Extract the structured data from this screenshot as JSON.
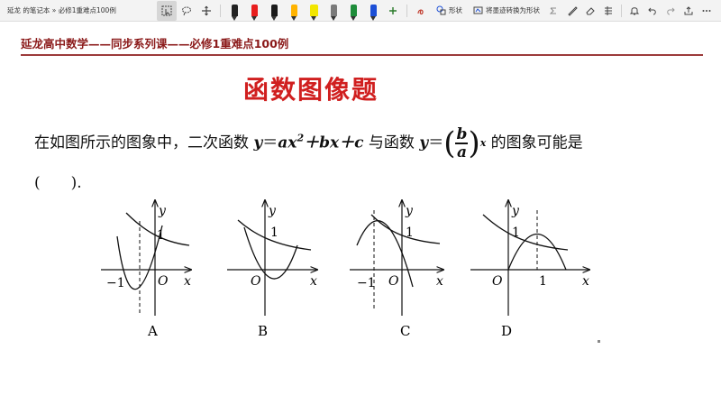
{
  "toolbar": {
    "notebook_title": "延龙 的笔记本 » 必修1重难点100例",
    "shape_label": "形状",
    "ink_to_shape_label": "将墨迹转换为形状",
    "pen_colors": [
      "#222222",
      "#e81e1e",
      "#1a1a1a",
      "#ffb300",
      "#f2e600",
      "#7a7a7a",
      "#1e8c3a",
      "#1c4fd6"
    ],
    "icons": [
      "select-icon",
      "lasso-icon",
      "pan-icon",
      "add-icon",
      "ink-replay-icon",
      "shape-icon",
      "ink-to-shape-icon",
      "ruler-icon",
      "eraser-icon",
      "align-icon",
      "bell-icon",
      "undo-icon",
      "redo-icon",
      "share-icon",
      "more-icon"
    ]
  },
  "header": {
    "series_title": "延龙高中数学——同步系列课——必修1重难点100例"
  },
  "main": {
    "title": "函数图像题",
    "question": {
      "part1": "在如图所示的图象中，二次函数 ",
      "func1_y": "y",
      "func1_eq": "＝",
      "func1_ax": "ax",
      "func1_sq": "2",
      "func1_rest": "＋bx＋c",
      "part2": " 与函数 ",
      "func2_y": "y",
      "func2_eq": "＝",
      "frac_num": "b",
      "frac_den": "a",
      "frac_exp": "x",
      "part3": " 的图象可能是"
    },
    "answer_blank": "(　　)."
  },
  "graphs": [
    {
      "label": "A",
      "axis_x": "x",
      "axis_y": "y",
      "origin": "O",
      "mark_one": "1",
      "mark_neg_one": "−1"
    },
    {
      "label": "B",
      "axis_x": "x",
      "axis_y": "y",
      "origin": "O",
      "mark_one": "1"
    },
    {
      "label": "C",
      "axis_x": "x",
      "axis_y": "y",
      "origin": "O",
      "mark_one": "1",
      "mark_neg_one": "−1"
    },
    {
      "label": "D",
      "axis_x": "x",
      "axis_y": "y",
      "origin": "O",
      "mark_one": "1",
      "mark_x_one": "1"
    }
  ]
}
